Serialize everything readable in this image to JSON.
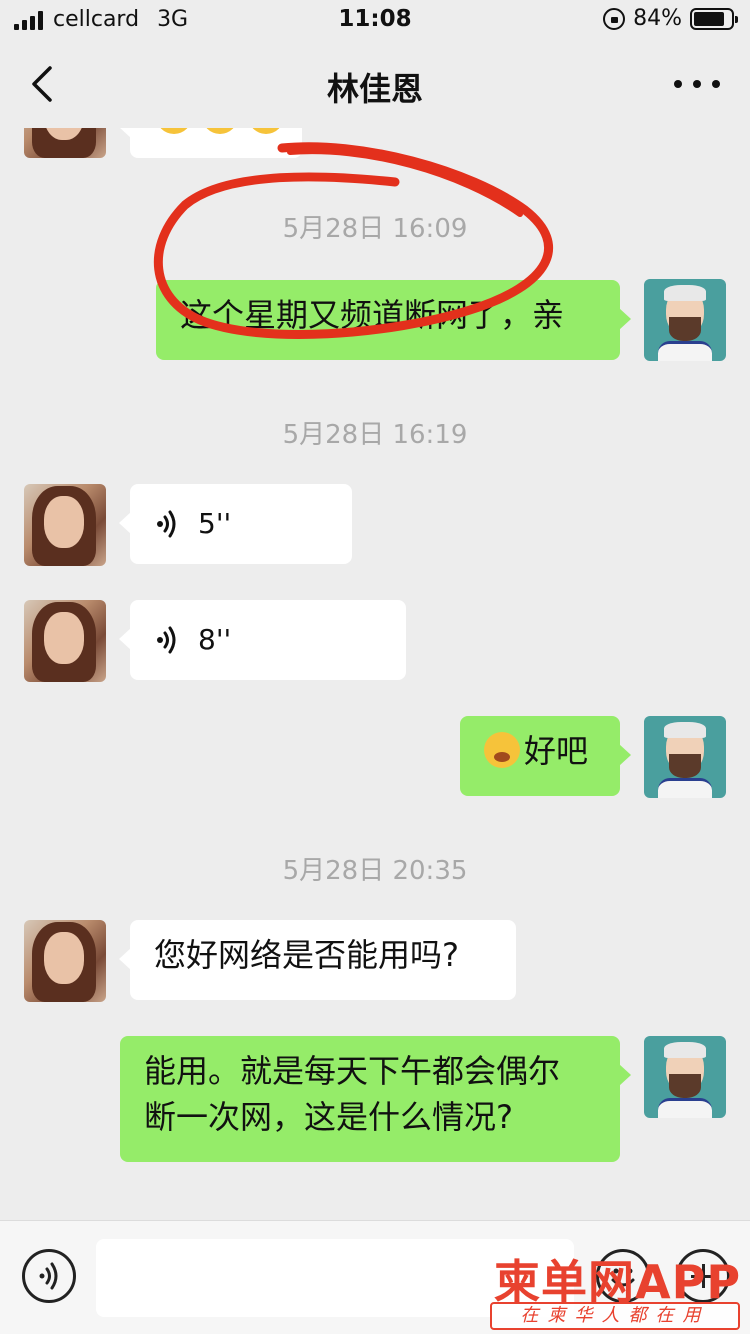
{
  "statusbar": {
    "carrier": "cellcard",
    "network": "3G",
    "time": "11:08",
    "battery": "84%",
    "battery_level": 0.84
  },
  "header": {
    "title": "林佳恩",
    "back_icon": "chevron-left-icon",
    "more_icon": "more-dots-icon"
  },
  "messages": {
    "ts1": "5月28日 16:09",
    "out1": "这个星期又频道断网了，亲",
    "ts2": "5月28日 16:19",
    "voice1": "5''",
    "voice2": "8''",
    "out2": "好吧",
    "ts3": "5月28日 20:35",
    "in3": "您好网络是否能用吗?",
    "out3_line1": "能用。就是每天下午都会偶尔",
    "out3_line2": "断一次网，这是什么情况?"
  },
  "watermark": {
    "brand": "柬单网APP",
    "slogan": "在柬华人都在用"
  },
  "colors": {
    "background": "#ededed",
    "outgoing_bubble": "#95ec69",
    "incoming_bubble": "#ffffff",
    "annotation": "#e3301c",
    "watermark": "#e8422f"
  }
}
